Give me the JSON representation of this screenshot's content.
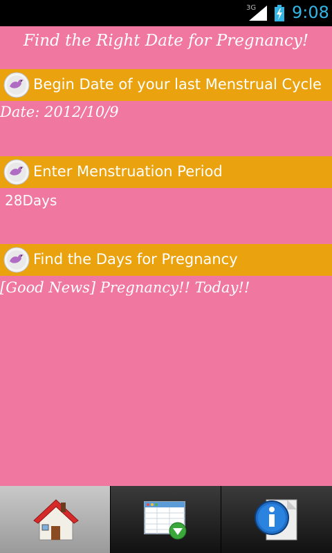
{
  "status_bar": {
    "network": "3G",
    "time": "9:08"
  },
  "app": {
    "title": "Find the Right Date for Pregnancy!"
  },
  "sections": [
    {
      "header": "Begin Date of your last Menstrual Cycle",
      "value": "Date: 2012/10/9"
    },
    {
      "header": "Enter Menstruation Period",
      "value": "28Days"
    },
    {
      "header": "Find the Days for Pregnancy",
      "value": "[Good News] Pregnancy!! Today!!"
    }
  ],
  "tabs": [
    {
      "icon": "home-icon",
      "selected": true
    },
    {
      "icon": "calendar-table-icon",
      "selected": false
    },
    {
      "icon": "info-icon",
      "selected": false
    }
  ],
  "colors": {
    "background": "#f078a0",
    "section_header": "#eaa20e",
    "clock": "#33b5e5"
  }
}
